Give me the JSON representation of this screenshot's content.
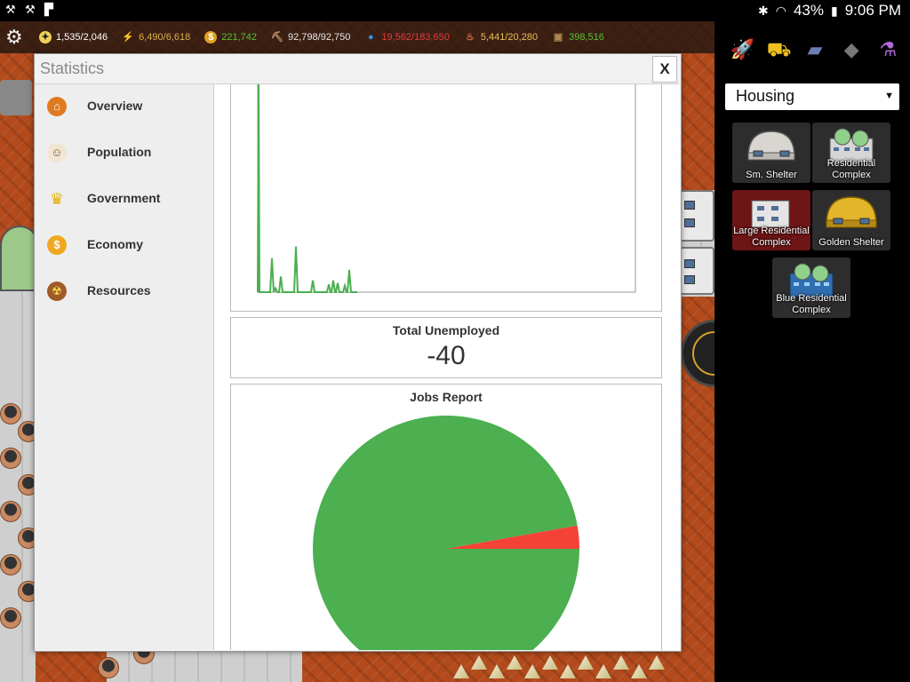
{
  "status_bar": {
    "battery": "43%",
    "time": "9:06 PM"
  },
  "resources": [
    {
      "icon": "lightbulb-icon",
      "value": "1,535/2,046",
      "color": "#ffffff"
    },
    {
      "icon": "lightning-icon",
      "value": "6,490/6,618",
      "color": "#d6b34a"
    },
    {
      "icon": "coin-icon",
      "value": "221,742",
      "color": "#55c233"
    },
    {
      "icon": "pickaxe-icon",
      "value": "92,798/92,750",
      "color": "#e8e8e8"
    },
    {
      "icon": "water-drop-icon",
      "value": "19,562/183,650",
      "color": "#e23d3d"
    },
    {
      "icon": "food-icon",
      "value": "5,441/20,280",
      "color": "#e8c15a"
    },
    {
      "icon": "crate-icon",
      "value": "398,516",
      "color": "#55c233"
    }
  ],
  "dialog": {
    "title": "Statistics",
    "close_label": "X",
    "nav": [
      {
        "id": "overview",
        "label": "Overview",
        "icon": "home-icon"
      },
      {
        "id": "population",
        "label": "Population",
        "icon": "people-icon"
      },
      {
        "id": "government",
        "label": "Government",
        "icon": "crown-icon"
      },
      {
        "id": "economy",
        "label": "Economy",
        "icon": "dollar-coin-icon"
      },
      {
        "id": "resources",
        "label": "Resources",
        "icon": "resources-icon"
      }
    ],
    "unemployed": {
      "title": "Total Unemployed",
      "value": "-40"
    },
    "jobs_report": {
      "title": "Jobs Report"
    }
  },
  "chart_data": [
    {
      "type": "line",
      "title": "",
      "color": "#4caf50",
      "x": [
        0,
        1,
        2,
        3,
        4,
        5,
        6,
        7,
        8,
        9,
        10,
        11,
        12,
        13,
        14,
        15,
        16,
        17,
        18,
        19,
        20,
        21,
        22,
        23,
        24,
        25,
        26,
        27,
        28,
        29,
        30,
        31,
        32,
        33,
        34,
        35,
        36,
        37,
        38,
        39,
        40,
        41,
        42,
        43,
        44,
        45,
        46,
        47,
        48,
        49,
        50,
        51,
        52,
        53,
        54,
        55,
        56,
        57,
        58,
        59,
        60,
        61,
        62,
        63,
        64,
        65,
        66,
        67,
        68,
        69,
        70,
        71,
        72,
        73,
        74,
        75,
        76,
        77,
        78,
        79,
        80,
        81,
        82,
        83,
        84,
        85,
        86,
        87,
        88,
        89,
        90,
        91,
        92,
        93,
        94,
        95,
        96,
        97,
        98,
        99,
        100,
        101,
        102,
        103,
        104,
        105,
        106,
        107,
        108,
        109,
        110,
        111,
        112
      ],
      "values": [
        0,
        320,
        0,
        0,
        0,
        0,
        0,
        0,
        0,
        0,
        0,
        0,
        0,
        0,
        0,
        0,
        0,
        0,
        0,
        0,
        0,
        0,
        0,
        0,
        0,
        0,
        0,
        0,
        0,
        0,
        0,
        0,
        0,
        0,
        0,
        0,
        0,
        0,
        0,
        0,
        0,
        0,
        0,
        0,
        0,
        0,
        0,
        0,
        0,
        0,
        0,
        0,
        0,
        0,
        0,
        0,
        0,
        0,
        0,
        0,
        0,
        0,
        0,
        0,
        0,
        0,
        0,
        0,
        0,
        0,
        0,
        0,
        0,
        0,
        0,
        0,
        0,
        0,
        0,
        0,
        0,
        0,
        0,
        0,
        0,
        0,
        0,
        0,
        0,
        0,
        0,
        0,
        0,
        0,
        0,
        0,
        0,
        0,
        0,
        0,
        0,
        0,
        0,
        0,
        0,
        0,
        0,
        0,
        0,
        0,
        0,
        0,
        0
      ],
      "spikes": [
        {
          "x": 16,
          "y": 52
        },
        {
          "x": 20,
          "y": 6
        },
        {
          "x": 26,
          "y": 24
        },
        {
          "x": 43,
          "y": 70
        },
        {
          "x": 62,
          "y": 18
        },
        {
          "x": 80,
          "y": 12
        },
        {
          "x": 85,
          "y": 18
        },
        {
          "x": 90,
          "y": 14
        },
        {
          "x": 98,
          "y": 10
        },
        {
          "x": 103,
          "y": 34
        }
      ],
      "xlim": [
        0,
        425
      ],
      "ylim": [
        0,
        320
      ]
    },
    {
      "type": "pie",
      "title": "Jobs Report",
      "slices": [
        {
          "label": "",
          "value": 97.2,
          "color": "#4caf50"
        },
        {
          "label": "",
          "value": 2.8,
          "color": "#f44336"
        }
      ]
    }
  ],
  "sidebar": {
    "category_icons": [
      "rocket-icon",
      "bulldozer-icon",
      "solar-panel-icon",
      "crate-icon",
      "flask-icon"
    ],
    "dropdown": {
      "value": "Housing"
    },
    "buildings": [
      {
        "id": "sm-shelter",
        "label": "Sm. Shelter",
        "selected": false
      },
      {
        "id": "residential-complex",
        "label": "Residential Complex",
        "selected": false
      },
      {
        "id": "large-residential-complex",
        "label": "Large Residential Complex",
        "selected": true
      },
      {
        "id": "golden-shelter",
        "label": "Golden Shelter",
        "selected": false
      },
      {
        "id": "blue-residential-complex",
        "label": "Blue Residential Complex",
        "selected": false
      }
    ]
  }
}
